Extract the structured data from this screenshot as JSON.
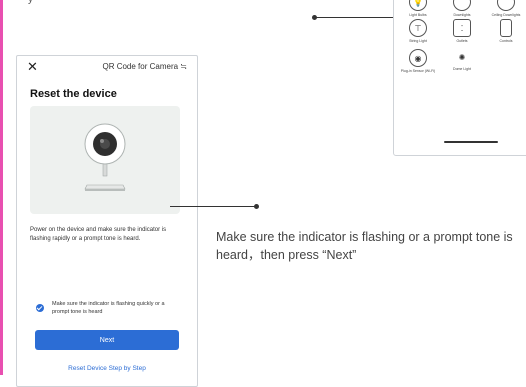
{
  "fragment_text": "y",
  "phone": {
    "close_glyph": "✕",
    "header_title": "QR Code for Camera ≒",
    "title": "Reset the device",
    "instruction": "Power on the device and make sure the indicator is flashing rapidly or a prompt tone is heard.",
    "checkbox_label": "Make sure the indicator is flashing quickly or a prompt tone is heard",
    "checkbox_checked": true,
    "next_label": "Next",
    "reset_link": "Reset Device Step by Step"
  },
  "annotation": "Make sure the indicator is flashing or a prompt tone is heard，then press “Next”",
  "device_list": {
    "items": [
      {
        "label": "Light Bulbs",
        "icon": "bulb-icon"
      },
      {
        "label": "Downlights",
        "icon": "downlight-icon"
      },
      {
        "label": "Ceiling Downlights",
        "icon": "ceiling-light-icon"
      },
      {
        "label": "String Light",
        "icon": "string-light-icon"
      },
      {
        "label": "Outlets",
        "icon": "outlet-icon"
      },
      {
        "label": "Controls",
        "icon": "control-icon"
      },
      {
        "label": "Plug-in Sensor (Wi-Fi)",
        "icon": "plug-sensor-icon"
      },
      {
        "label": "Dome Light",
        "icon": "dome-light-icon"
      }
    ]
  },
  "colors": {
    "accent": "#2c6dd5",
    "edge": "#e84fb0",
    "card": "#eef1ef"
  }
}
